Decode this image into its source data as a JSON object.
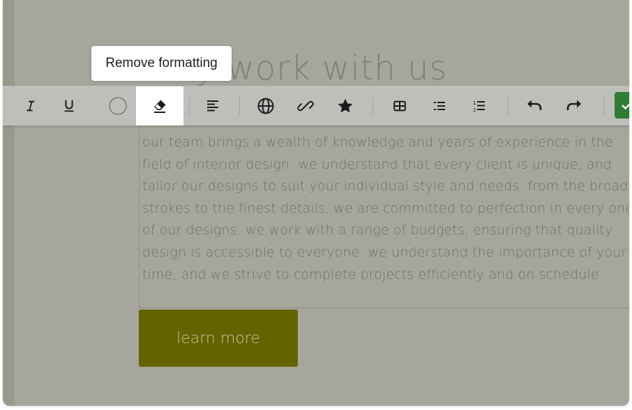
{
  "heading": "Why work with us",
  "paragraph_lines": [
    "our team brings a wealth of knowledge and years of experience in the",
    "field of interior design. we understand that every client is unique, and",
    "tailor our designs to suit your individual style and needs. from the broad",
    "strokes to the finest details, we are committed to perfection in every one",
    "of our designs. we work with a range of budgets, ensuring that quality",
    "design is accessible to everyone. we understand the importance of your",
    "time, and we strive to complete projects efficiently and on schedule."
  ],
  "cta": {
    "label": "learn more"
  },
  "tooltip": {
    "text": "Remove formatting"
  },
  "toolbar": {
    "icons": [
      "italic-icon",
      "underline-icon",
      "text-color-icon",
      "remove-formatting-icon",
      "align-left-icon",
      "globe-icon",
      "link-icon",
      "star-icon",
      "table-icon",
      "bullet-list-icon",
      "numbered-list-icon",
      "undo-icon",
      "redo-icon",
      "check-icon"
    ],
    "active": "remove-formatting-icon"
  },
  "colors": {
    "overlay": "#a6a69d",
    "toolbar": "#bebebb",
    "button": "#656200",
    "confirm": "#2e7d32"
  }
}
